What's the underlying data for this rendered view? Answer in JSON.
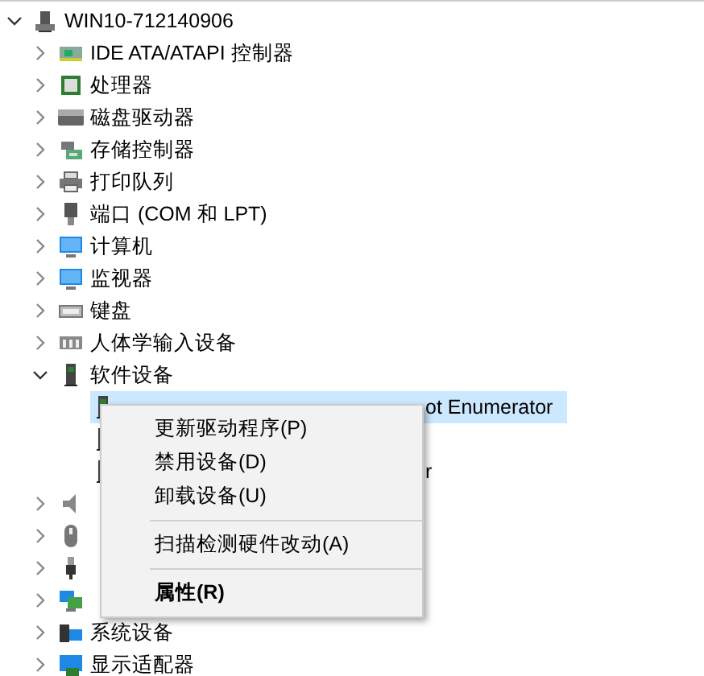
{
  "tree": [
    {
      "label": "WIN10-712140906",
      "kind": "computer",
      "expanded": true,
      "selected": false,
      "children": [
        {
          "label": "IDE ATA/ATAPI 控制器",
          "kind": "ide",
          "expanded": false,
          "selected": false
        },
        {
          "label": "处理器",
          "kind": "cpu",
          "expanded": false,
          "selected": false
        },
        {
          "label": "磁盘驱动器",
          "kind": "disk",
          "expanded": false,
          "selected": false
        },
        {
          "label": "存储控制器",
          "kind": "storage",
          "expanded": false,
          "selected": false
        },
        {
          "label": "打印队列",
          "kind": "printer",
          "expanded": false,
          "selected": false
        },
        {
          "label": "端口 (COM 和 LPT)",
          "kind": "port",
          "expanded": false,
          "selected": false
        },
        {
          "label": "计算机",
          "kind": "monitor",
          "expanded": false,
          "selected": false
        },
        {
          "label": "监视器",
          "kind": "monitor",
          "expanded": false,
          "selected": false
        },
        {
          "label": "键盘",
          "kind": "keyboard",
          "expanded": false,
          "selected": false
        },
        {
          "label": "人体学输入设备",
          "kind": "hid",
          "expanded": false,
          "selected": false
        },
        {
          "label": "软件设备",
          "kind": "software",
          "expanded": true,
          "selected": false,
          "children": [
            {
              "label": "ot Enumerator",
              "cut": true,
              "kind": "software",
              "selected": true
            },
            {
              "kind": "software",
              "selected": false
            },
            {
              "label": "r",
              "cut": true,
              "kind": "software",
              "selected": false
            }
          ]
        },
        {
          "kind": "sound",
          "expanded": false,
          "selected": false
        },
        {
          "kind": "mouse",
          "expanded": false,
          "selected": false
        },
        {
          "kind": "usb",
          "expanded": false,
          "selected": false
        },
        {
          "kind": "network",
          "expanded": false,
          "selected": false
        },
        {
          "label": "系统设备",
          "kind": "system",
          "expanded": false,
          "selected": false
        },
        {
          "label": "显示适配器",
          "kind": "display",
          "expanded": false,
          "selected": false
        }
      ]
    }
  ],
  "context_menu": [
    {
      "kind": "item",
      "label": "更新驱动程序(P)"
    },
    {
      "kind": "item",
      "label": "禁用设备(D)"
    },
    {
      "kind": "item",
      "label": "卸载设备(U)"
    },
    {
      "kind": "separator"
    },
    {
      "kind": "item",
      "label": "扫描检测硬件改动(A)"
    },
    {
      "kind": "separator"
    },
    {
      "kind": "default",
      "label": "属性(R)"
    }
  ]
}
